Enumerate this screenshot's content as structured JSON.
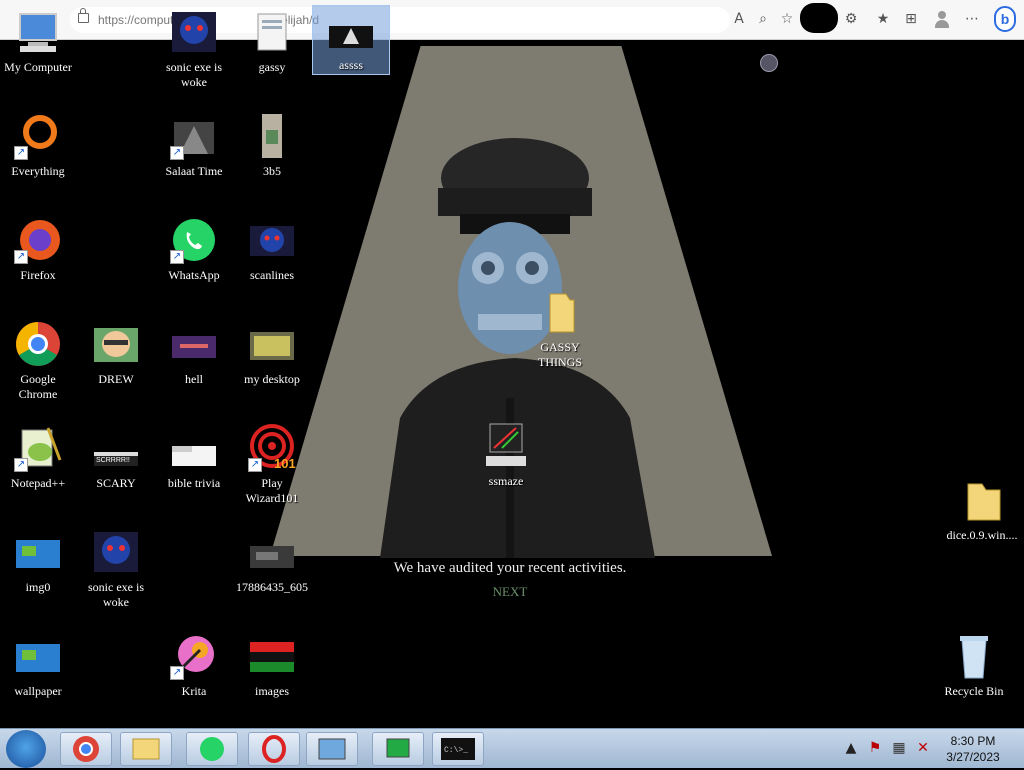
{
  "browser": {
    "url": "https://computer",
    "url_suffix": "~elijah/d"
  },
  "desktop_icons": {
    "my_computer": "My Computer",
    "everything": "Everything",
    "firefox": "Firefox",
    "chrome": "Google Chrome",
    "notepadpp": "Notepad++",
    "img0": "img0",
    "wallpaper": "wallpaper",
    "drew": "DREW",
    "scary": "SCARY",
    "scary_img_text": "SCRRRR!!",
    "sonic2": "sonic exe is woke",
    "sonic1": "sonic exe is woke",
    "salaat": "Salaat Time",
    "whatsapp": "WhatsApp",
    "hell": "hell",
    "bible": "bible trivia",
    "krita": "Krita",
    "gassy": "gassy",
    "b35": "3b5",
    "scanlines": "scanlines",
    "mydesktop": "my desktop",
    "wizard": "Play Wizard101",
    "wizard_badge": "101",
    "num": "17886435_605",
    "images": "images",
    "assss": "assss",
    "gassy_things": "GASSY THINGS",
    "ssmaze": "ssmaze",
    "dice": "dice.0.9.win....",
    "recycle": "Recycle Bin"
  },
  "screen_message": {
    "text": "We have audited your recent activities.",
    "next": "NEXT"
  },
  "taskbar": {
    "cmd_text": "C:\\>_",
    "time": "8:30 PM",
    "date": "3/27/2023"
  },
  "colors": {
    "taskbar": "#b9cce2",
    "spotlight": "#7e7b70",
    "face": "#6f8fae"
  }
}
